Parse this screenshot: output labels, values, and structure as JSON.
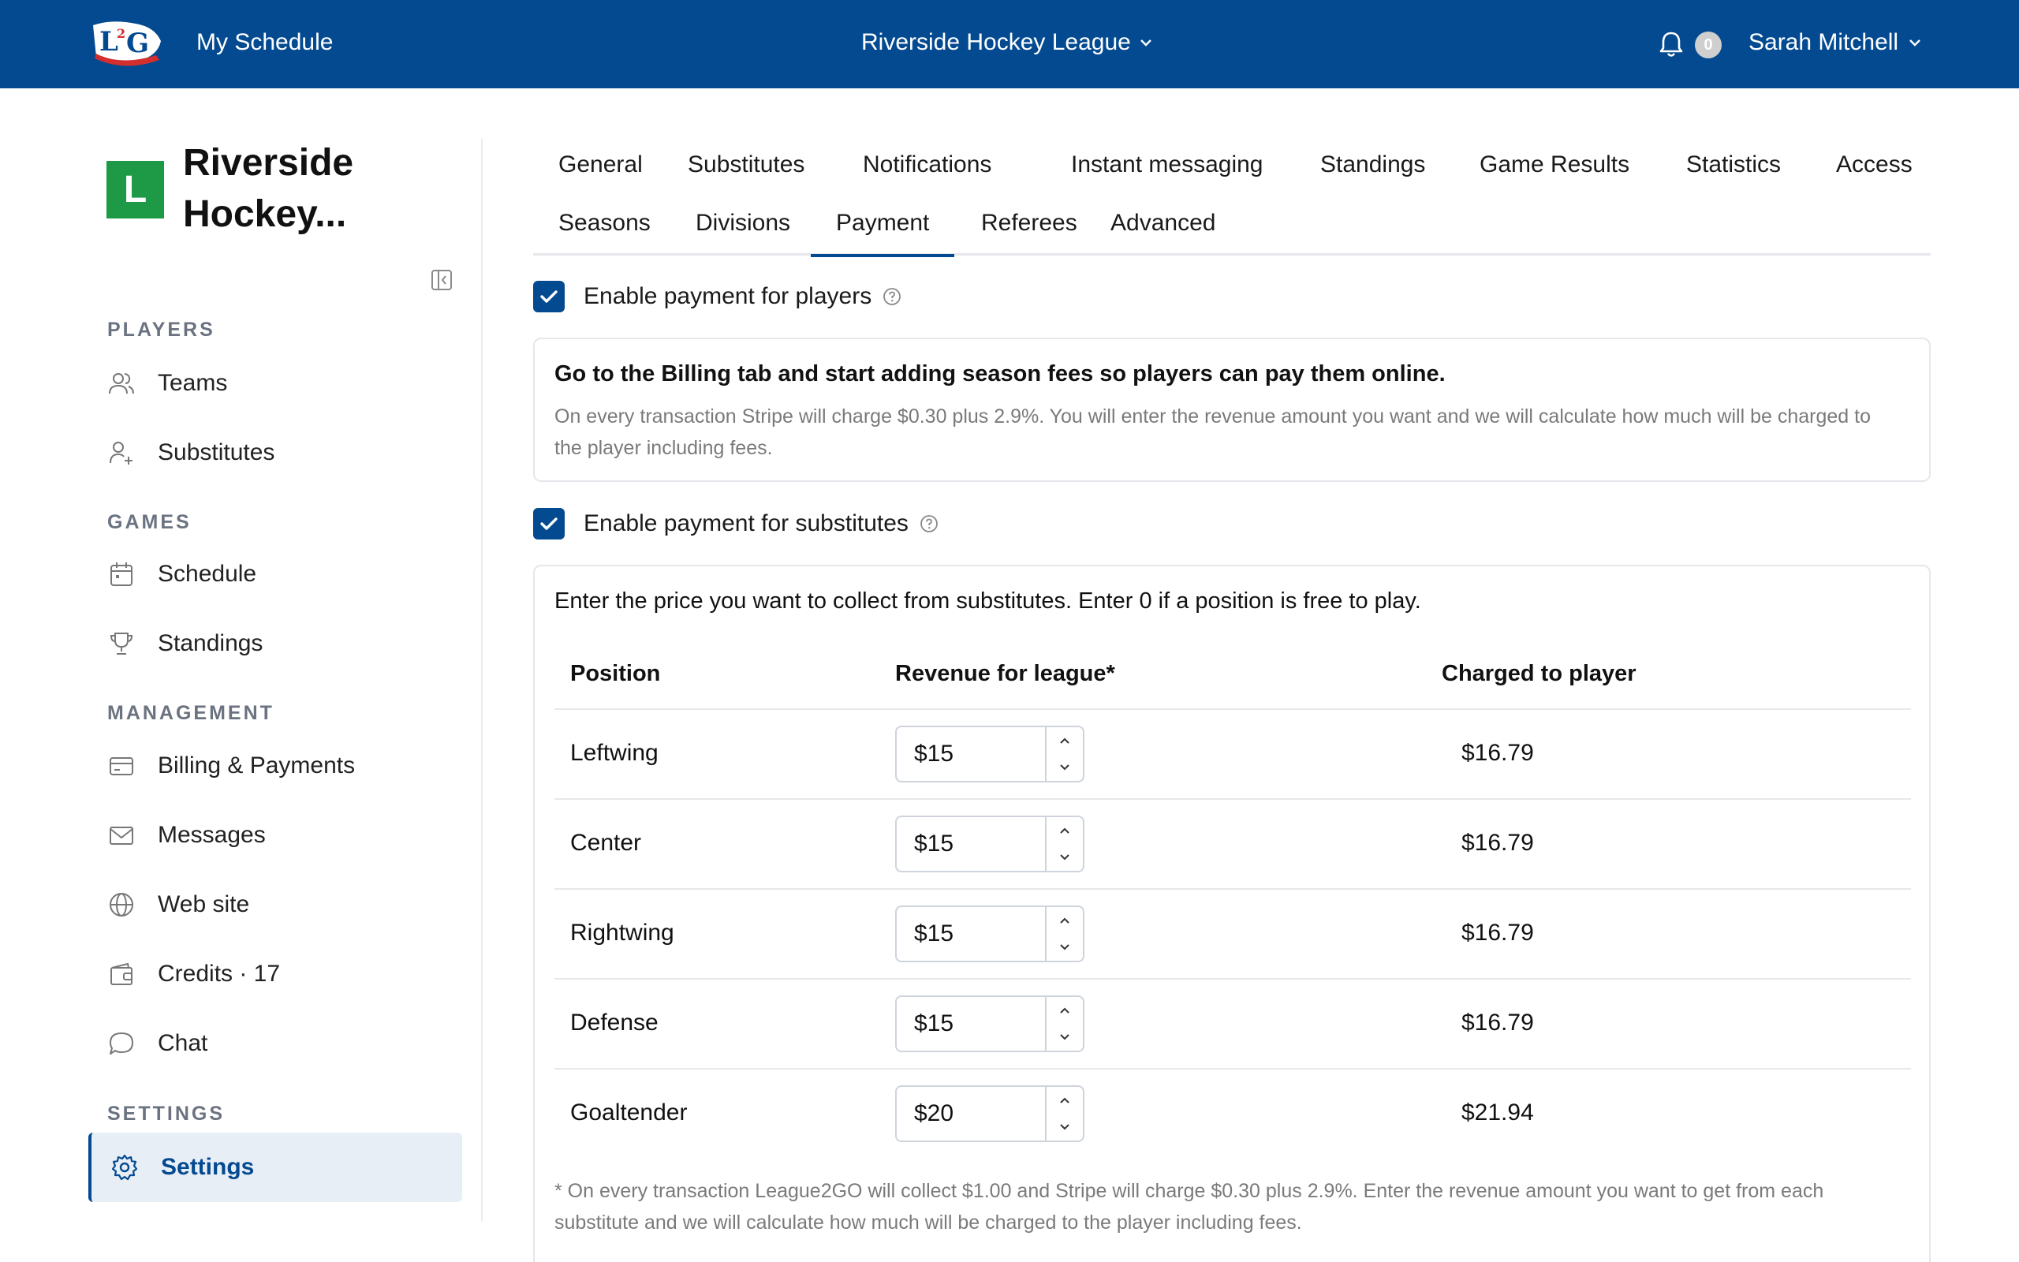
{
  "topbar": {
    "my_schedule": "My Schedule",
    "league": "Riverside Hockey League",
    "notification_count": "0",
    "user_name": "Sarah Mitchell",
    "color": "#044a91"
  },
  "sidebar": {
    "org_initial": "L",
    "org_name": "Riverside Hockey...",
    "sections": {
      "players": "PLAYERS",
      "games": "GAMES",
      "management": "MANAGEMENT",
      "settings": "SETTINGS"
    },
    "items": {
      "teams": "Teams",
      "substitutes": "Substitutes",
      "schedule": "Schedule",
      "standings": "Standings",
      "billing": "Billing & Payments",
      "messages": "Messages",
      "website": "Web site",
      "credits": "Credits · 17",
      "chat": "Chat",
      "settings": "Settings"
    }
  },
  "tabs": {
    "general": "General",
    "substitutes": "Substitutes",
    "notifications": "Notifications",
    "instant_messaging": "Instant messaging",
    "standings": "Standings",
    "game_results": "Game Results",
    "statistics": "Statistics",
    "access": "Access",
    "seasons": "Seasons",
    "divisions": "Divisions",
    "payment": "Payment",
    "referees": "Referees",
    "advanced": "Advanced",
    "active": "Payment"
  },
  "payment": {
    "enable_players_label": "Enable payment for players",
    "enable_players_checked": true,
    "players_info_title": "Go to the Billing tab and start adding season fees so players can pay them online.",
    "players_info_text": "On every transaction Stripe will charge $0.30 plus 2.9%. You will enter the revenue amount you want and we will calculate how much will be charged to the player including fees.",
    "enable_subs_label": "Enable payment for substitutes",
    "enable_subs_checked": true,
    "subs_intro": "Enter the price you want to collect from substitutes. Enter 0 if a position is free to play.",
    "columns": {
      "position": "Position",
      "revenue": "Revenue for league*",
      "charged": "Charged to player"
    },
    "rows": [
      {
        "position": "Leftwing",
        "revenue": "$15",
        "charged": "$16.79"
      },
      {
        "position": "Center",
        "revenue": "$15",
        "charged": "$16.79"
      },
      {
        "position": "Rightwing",
        "revenue": "$15",
        "charged": "$16.79"
      },
      {
        "position": "Defense",
        "revenue": "$15",
        "charged": "$16.79"
      },
      {
        "position": "Goaltender",
        "revenue": "$20",
        "charged": "$21.94"
      }
    ],
    "footnote": "* On every transaction League2GO will collect $1.00 and Stripe will charge $0.30 plus 2.9%. Enter the revenue amount you want to get from each substitute and we will calculate how much will be charged to the player including fees."
  }
}
